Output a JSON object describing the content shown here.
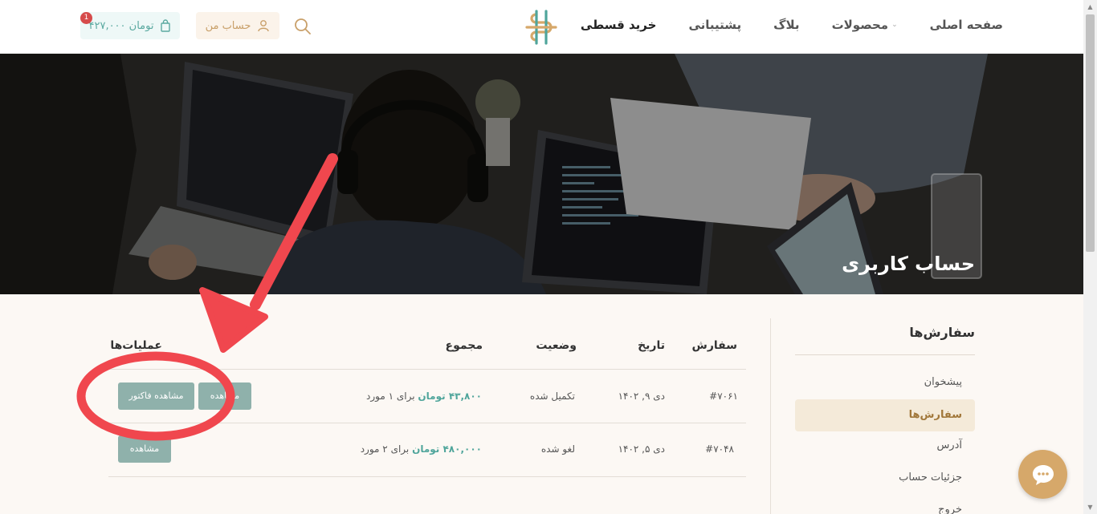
{
  "header": {
    "nav": [
      {
        "label": "صفحه اصلی"
      },
      {
        "label": "محصولات"
      },
      {
        "label": "بلاگ"
      },
      {
        "label": "پشتیبانی"
      },
      {
        "label": "خرید قسطی"
      }
    ],
    "account_label": "حساب من",
    "cart_total": "۴۲۷,۰۰۰ تومان",
    "cart_count": "1"
  },
  "hero": {
    "title": "حساب کاربری"
  },
  "sidebar": {
    "title": "سفارش‌ها",
    "items": [
      {
        "label": "پیشخوان"
      },
      {
        "label": "سفارش‌ها"
      },
      {
        "label": "آدرس"
      },
      {
        "label": "جزئیات حساب"
      },
      {
        "label": "خروج"
      }
    ]
  },
  "orders": {
    "columns": {
      "order": "سفارش",
      "date": "تاریخ",
      "status": "وضعیت",
      "total": "مجموع",
      "actions": "عملیات‌ها"
    },
    "rows": [
      {
        "number": "#۷۰۶۱",
        "date": "دی ۹, ۱۴۰۲",
        "status": "تکمیل شده",
        "amount": "۴۳,۸۰۰ تومان",
        "qty": "برای ۱ مورد",
        "view_label": "مشاهده",
        "invoice_label": "مشاهده فاکتور"
      },
      {
        "number": "#۷۰۴۸",
        "date": "دی ۵, ۱۴۰۲",
        "status": "لغو شده",
        "amount": "۴۸۰,۰۰۰ تومان",
        "qty": "برای ۲ مورد",
        "view_label": "مشاهده"
      }
    ]
  },
  "colors": {
    "accent_gold": "#d6a86a",
    "accent_teal": "#4fa59b",
    "button_teal": "#8fb1ab",
    "annotation_red": "#f0474e"
  }
}
